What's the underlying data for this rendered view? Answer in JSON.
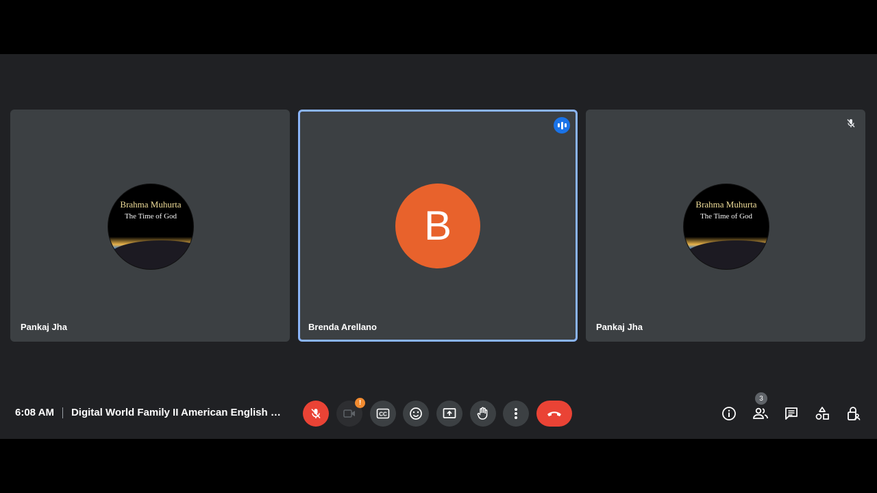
{
  "tiles": [
    {
      "name": "Pankaj Jha",
      "logo_line1": "Brahma Muhurta",
      "logo_line2": "The Time of God"
    },
    {
      "name": "Brenda Arellano",
      "initial": "B"
    },
    {
      "name": "Pankaj Jha",
      "logo_line1": "Brahma Muhurta",
      "logo_line2": "The Time of God"
    }
  ],
  "footer": {
    "time": "6:08 AM",
    "meeting_title": "Digital World Family II American English En..."
  },
  "controls": {
    "camera_warning": "!",
    "people_count": "3"
  },
  "colors": {
    "active_border": "#8ab4f8",
    "end_call": "#ea4335",
    "avatar_b": "#e8622c",
    "speaking": "#1a73e8"
  }
}
